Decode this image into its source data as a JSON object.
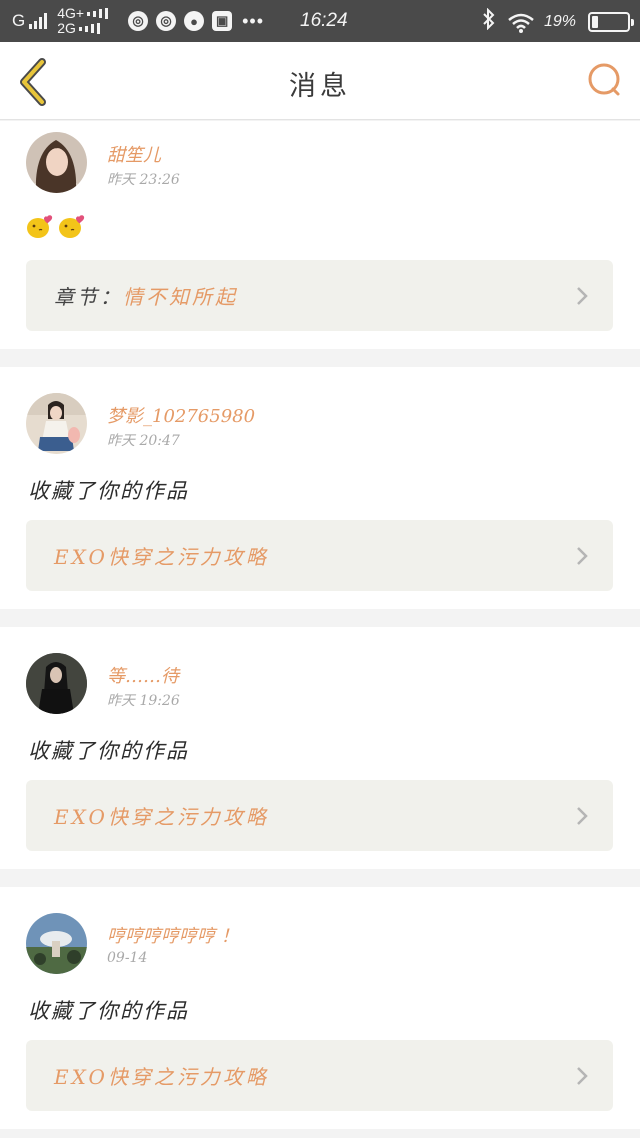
{
  "statusbar": {
    "carrier": "G",
    "net_top": "4G+",
    "net_bottom": "2G",
    "time": "16:24",
    "battery_text": "19%",
    "battery_level": 0.19,
    "dots": "•••"
  },
  "header": {
    "title": "消息"
  },
  "messages": [
    {
      "username": "甜笙儿",
      "time": "昨天 23:26",
      "action": "",
      "emojis": [
        "kiss-emoji",
        "kiss-emoji"
      ],
      "work_prefix": "章节：",
      "work_title": "情不知所起"
    },
    {
      "username": "梦影_102765980",
      "time": "昨天 20:47",
      "action": "收藏了你的作品",
      "work_prefix": "",
      "work_title": "EXO快穿之污力攻略"
    },
    {
      "username": "等……待",
      "time": "昨天 19:26",
      "action": "收藏了你的作品",
      "work_prefix": "",
      "work_title": "EXO快穿之污力攻略"
    },
    {
      "username": "哼哼哼哼哼哼 ！",
      "time": "09-14",
      "action": "收藏了你的作品",
      "work_prefix": "",
      "work_title": "EXO快穿之污力攻略"
    }
  ],
  "colors": {
    "accent": "#e59a66",
    "back_icon": "#e8c53a",
    "box_bg": "#f1f1ec",
    "statusbar": "#4a4a4a"
  }
}
